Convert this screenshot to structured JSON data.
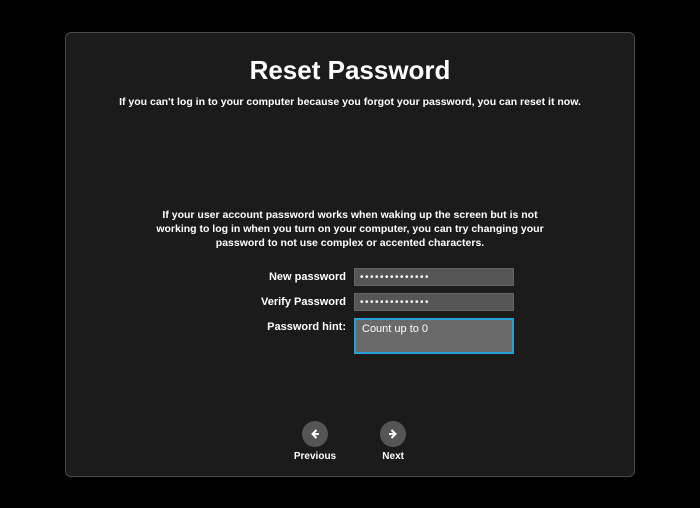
{
  "title": "Reset Password",
  "subtitle": "If you can't log in to your computer because you forgot your password, you can reset it now.",
  "info": "If your user account password works when waking up the screen but is not working to log in when you turn on your computer, you can try changing your password to not use complex or accented characters.",
  "fields": {
    "new_password": {
      "label": "New password",
      "value": "••••••••••••••"
    },
    "verify_password": {
      "label": "Verify Password",
      "value": "••••••••••••••"
    },
    "password_hint": {
      "label": "Password  hint:",
      "value": "Count up to 0"
    }
  },
  "buttons": {
    "previous": "Previous",
    "next": "Next"
  }
}
